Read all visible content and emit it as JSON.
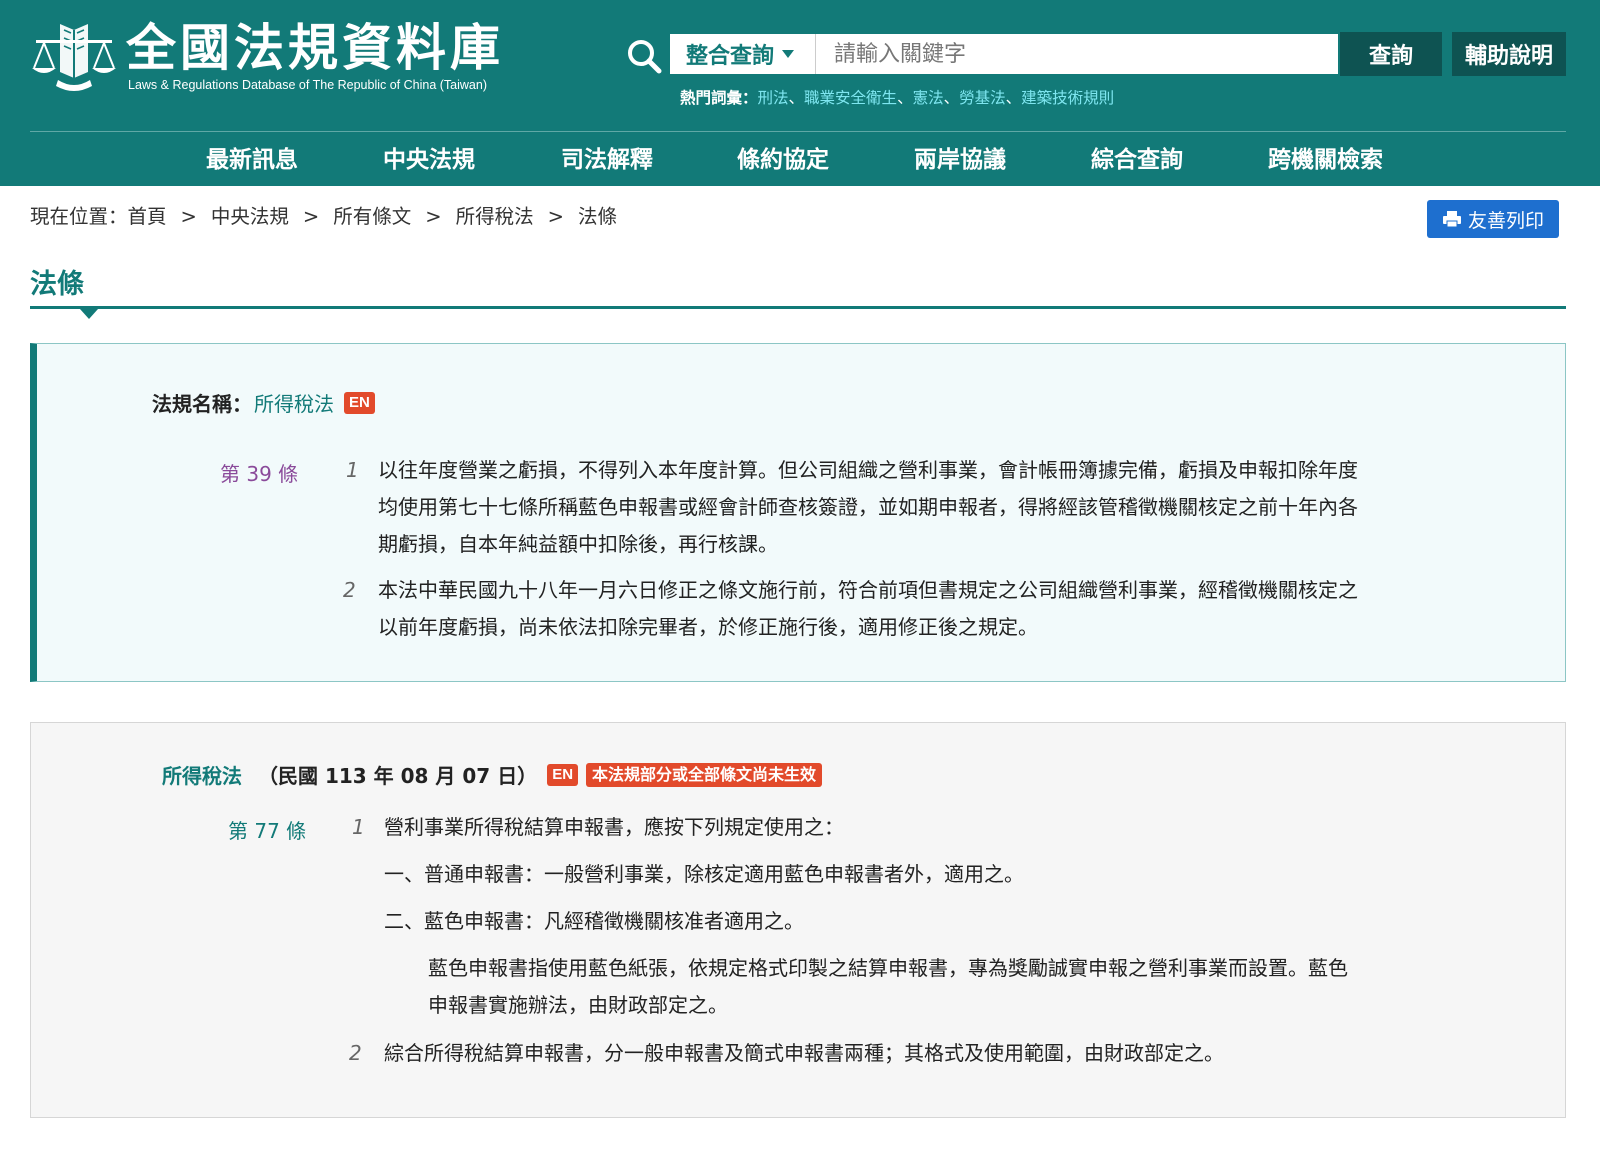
{
  "header": {
    "logo_title": "全國法規資料庫",
    "logo_subtitle": "Laws & Regulations Database of The Republic of China (Taiwan)",
    "search": {
      "scope": "整合查詢",
      "placeholder": "請輸入關鍵字",
      "query_button": "查詢",
      "help_button": "輔助說明"
    },
    "hot_terms": {
      "label": "熱門詞彙：",
      "terms": [
        "刑法",
        "職業安全衛生",
        "憲法",
        "勞基法",
        "建築技術規則"
      ],
      "separator": "、"
    },
    "nav": [
      "最新訊息",
      "中央法規",
      "司法解釋",
      "條約協定",
      "兩岸協議",
      "綜合查詢",
      "跨機關檢索"
    ]
  },
  "breadcrumb": {
    "prefix": "現在位置：",
    "items": [
      "首頁",
      "中央法規",
      "所有條文",
      "所得稅法",
      "法條"
    ],
    "separator": ">"
  },
  "print_button": "友善列印",
  "section_title": "法條",
  "article1": {
    "law_name_label": "法規名稱：",
    "law_name": "所得稅法",
    "en_badge": "EN",
    "article_no": "第 39 條",
    "paragraphs": [
      {
        "no": "1",
        "lines": [
          "以往年度營業之虧損，不得列入本年度計算。但公司組織之營利事業，會計帳冊簿據完備，虧損及申報扣除年度",
          "均使用第七十七條所稱藍色申報書或經會計師查核簽證，並如期申報者，得將經該管稽徵機關核定之前十年內各",
          "期虧損，自本年純益額中扣除後，再行核課。"
        ]
      },
      {
        "no": "2",
        "lines": [
          "本法中華民國九十八年一月六日修正之條文施行前，符合前項但書規定之公司組織營利事業，經稽徵機關核定之",
          "以前年度虧損，尚未依法扣除完畢者，於修正施行後，適用修正後之規定。"
        ]
      }
    ]
  },
  "article2": {
    "law_name": "所得稅法",
    "date": "（民國 113 年 08 月 07 日）",
    "en_badge": "EN",
    "warning": "本法規部分或全部條文尚未生效",
    "article_no": "第 77 條",
    "para1_no": "1",
    "para1_text": "營利事業所得稅結算申報書，應按下列規定使用之：",
    "item1": "一、普通申報書：一般營利事業，除核定適用藍色申報書者外，適用之。",
    "item2": "二、藍色申報書：凡經稽徵機關核准者適用之。",
    "item2_note": [
      "藍色申報書指使用藍色紙張，依規定格式印製之結算申報書，專為獎勵誠實申報之營利事業而設置。藍色",
      "申報書實施辦法，由財政部定之。"
    ],
    "para2_no": "2",
    "para2_text": "綜合所得稅結算申報書，分一般申報書及簡式申報書兩種；其格式及使用範圍，由財政部定之。"
  },
  "colors": {
    "brand": "#127a78",
    "header_button": "#0e5352",
    "hot_link": "#7ee6f0",
    "print_button": "#1e6fcf",
    "badge": "#e24a2b",
    "article_no_1": "#8a4a9a"
  },
  "icons": {
    "logo": "scales-books-emblem",
    "search": "search-icon",
    "print": "printer-icon"
  }
}
